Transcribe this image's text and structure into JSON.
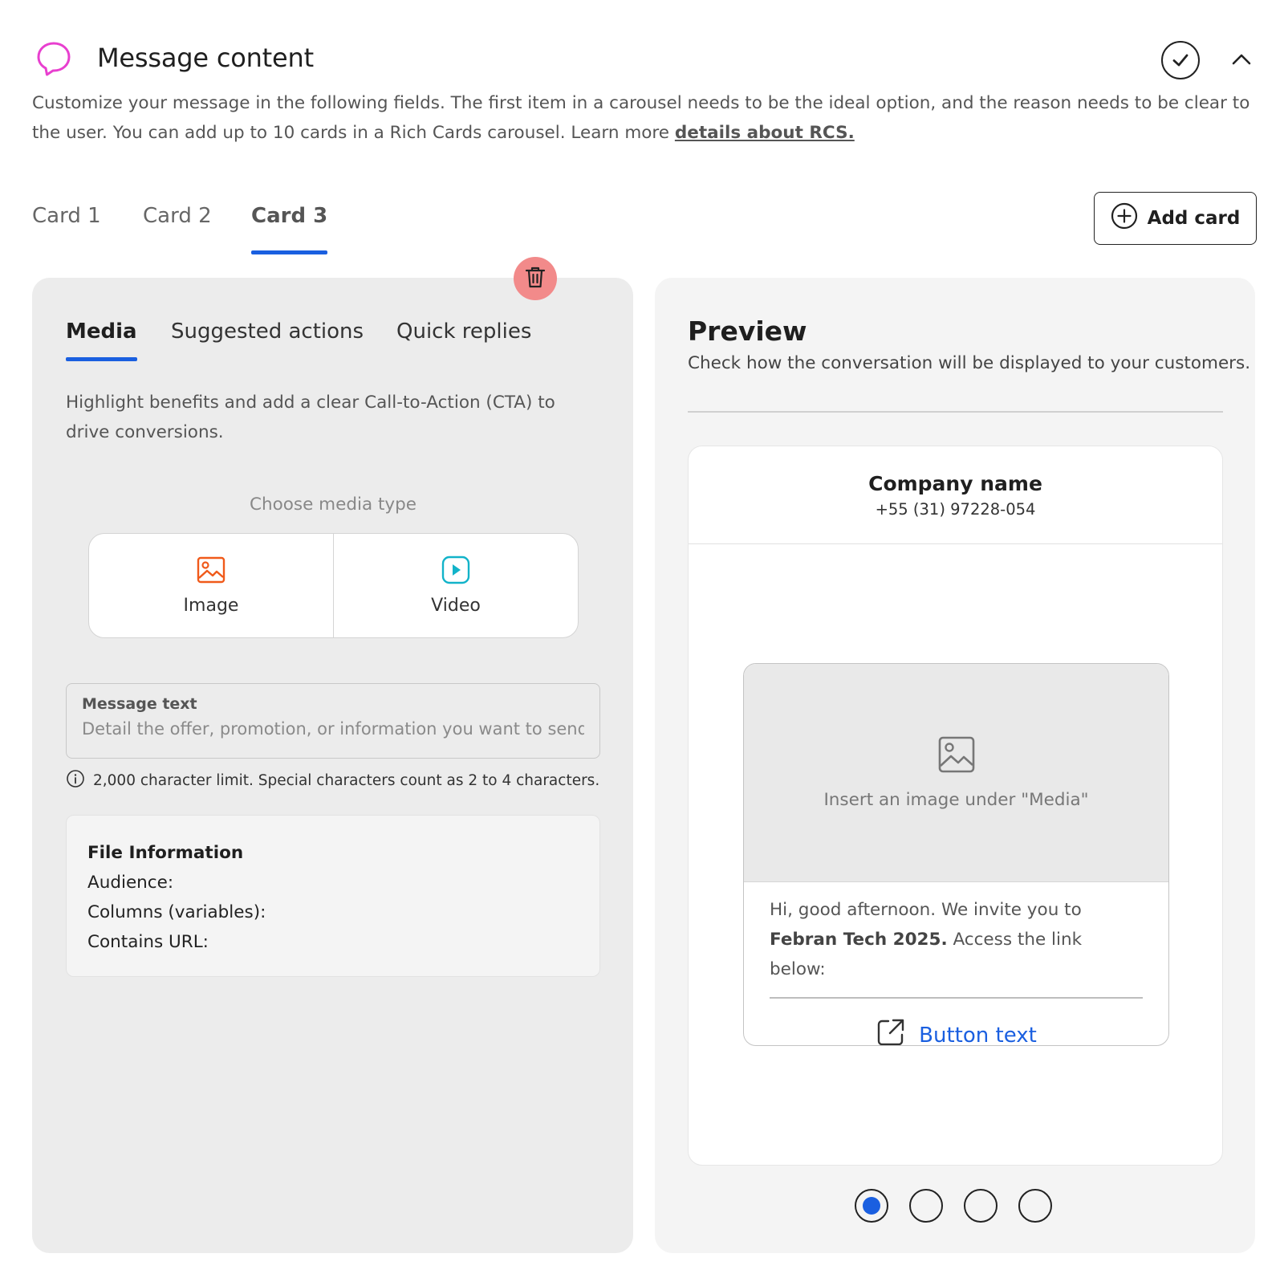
{
  "section": {
    "title": "Message content",
    "description": "Customize your message in the following fields. The first item in a carousel needs to be the ideal option, and the reason needs to be clear to the user. You can add up to 10 cards in a Rich Cards carousel. Learn more ",
    "link_text": "details about RCS.",
    "header_icon": "speech-bubble-icon",
    "status_icon": "check-circle-icon",
    "collapse_icon": "chevron-up-icon"
  },
  "card_tabs": [
    {
      "label": "Card 1",
      "active": false
    },
    {
      "label": "Card 2",
      "active": false
    },
    {
      "label": "Card 3",
      "active": true
    }
  ],
  "add_card": {
    "label": "Add card",
    "icon": "plus-circle-icon"
  },
  "editor": {
    "delete_icon": "trash-icon",
    "tabs": [
      {
        "label": "Media",
        "active": true
      },
      {
        "label": "Suggested actions",
        "active": false
      },
      {
        "label": "Quick replies",
        "active": false
      }
    ],
    "media_description": "Highlight benefits and add a clear Call-to-Action (CTA) to drive conversions.",
    "choose_media_label": "Choose media type",
    "media_options": [
      {
        "label": "Image",
        "icon": "image-icon",
        "color": "#f05a1a"
      },
      {
        "label": "Video",
        "icon": "video-play-icon",
        "color": "#12b3c9"
      }
    ],
    "message_text": {
      "label": "Message text",
      "placeholder": "Detail the offer, promotion, or information you want to send",
      "value": ""
    },
    "char_hint": "2,000 character limit. Special characters count as 2 to 4 characters.",
    "file_info": {
      "title": "File Information",
      "audience": "Audience:",
      "columns": "Columns (variables):",
      "contains_url": "Contains URL:"
    }
  },
  "preview": {
    "title": "Preview",
    "subtitle": "Check how the conversation will be displayed to your customers.",
    "company_name": "Company name",
    "company_phone": "+55 (31) 97228-054",
    "media_placeholder": "Insert an image under \"Media\"",
    "message_intro": "Hi, good afternoon. We invite you to ",
    "message_bold": "Febran Tech 2025.",
    "message_outro": " Access the link below:",
    "button_text": "Button text",
    "button_icon": "external-link-icon",
    "carousel_dots": 4,
    "active_dot": 1
  },
  "colors": {
    "accent": "#1a5fe0",
    "delete": "#f28a8a",
    "brand_icon": "#e83fcf",
    "image_icon": "#f05a1a",
    "video_icon": "#12b3c9"
  }
}
